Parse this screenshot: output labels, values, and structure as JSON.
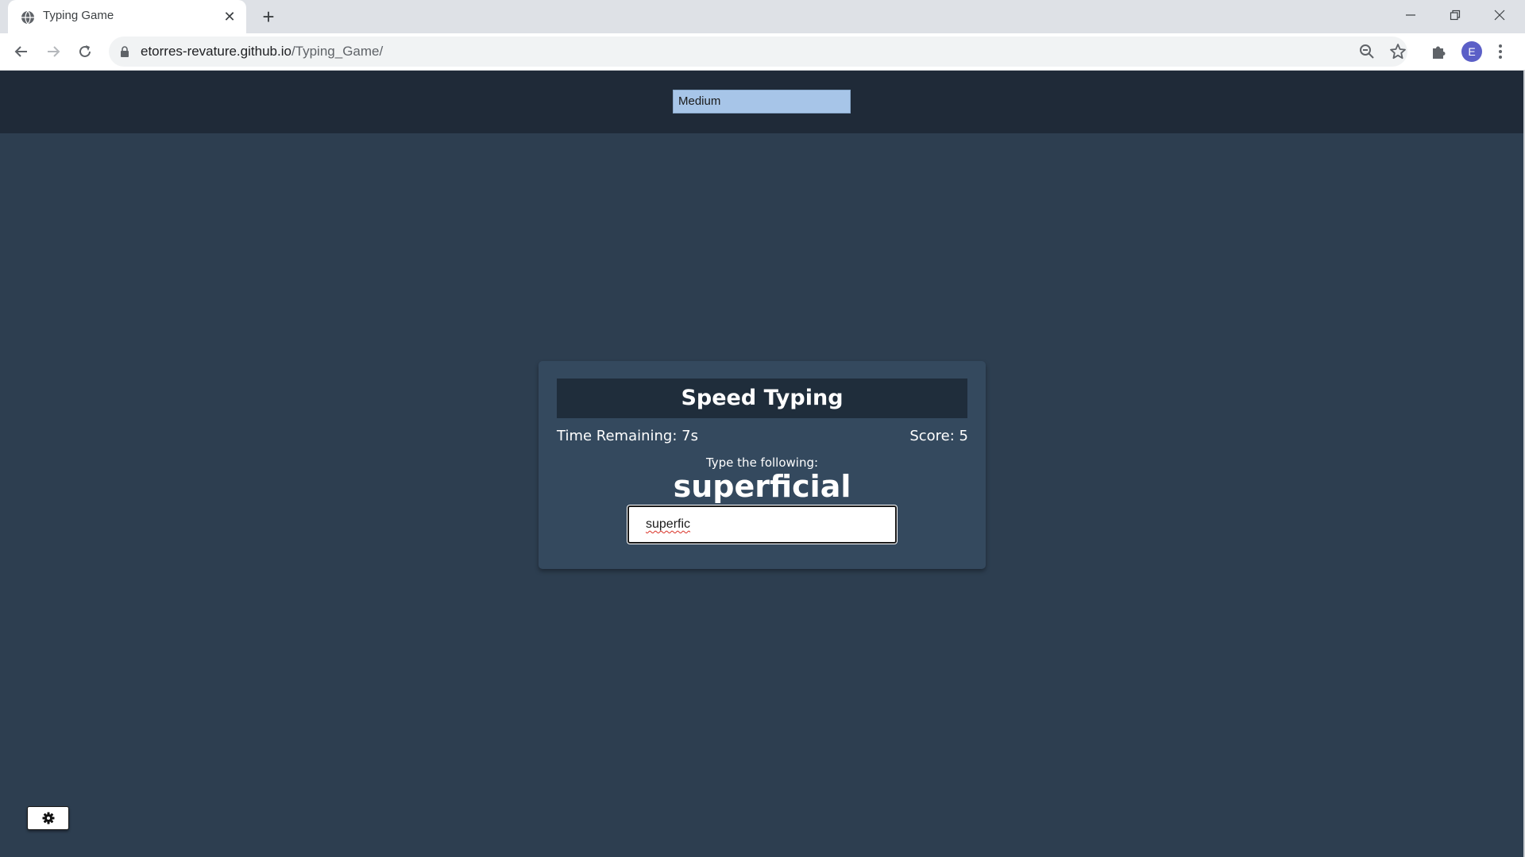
{
  "browser": {
    "tab_title": "Typing Game",
    "tab_close": "✕",
    "new_tab": "+",
    "url_host": "etorres-revature.github.io",
    "url_path": "/Typing_Game/",
    "profile_initial": "E"
  },
  "game": {
    "difficulty": "Medium",
    "title": "Speed Typing",
    "time_remaining": "Time Remaining: 7s",
    "score": "Score: 5",
    "prompt": "Type the following:",
    "word": "superficial",
    "typed": "superfic"
  },
  "icons": {
    "favicon": "globe-icon",
    "back": "back-arrow-icon",
    "forward": "forward-arrow-icon",
    "reload": "reload-icon",
    "lock": "lock-icon",
    "zoom": "zoom-icon",
    "bookmark": "star-icon",
    "extensions": "puzzle-icon",
    "menu": "kebab-menu-icon",
    "settings": "gear-icon"
  },
  "colors": {
    "page_bg": "#2d3e50",
    "topbar_bg": "#1f2a38",
    "card_bg": "#34495e",
    "title_bg": "#1f2d3b",
    "select_bg": "#a7c5e8"
  }
}
